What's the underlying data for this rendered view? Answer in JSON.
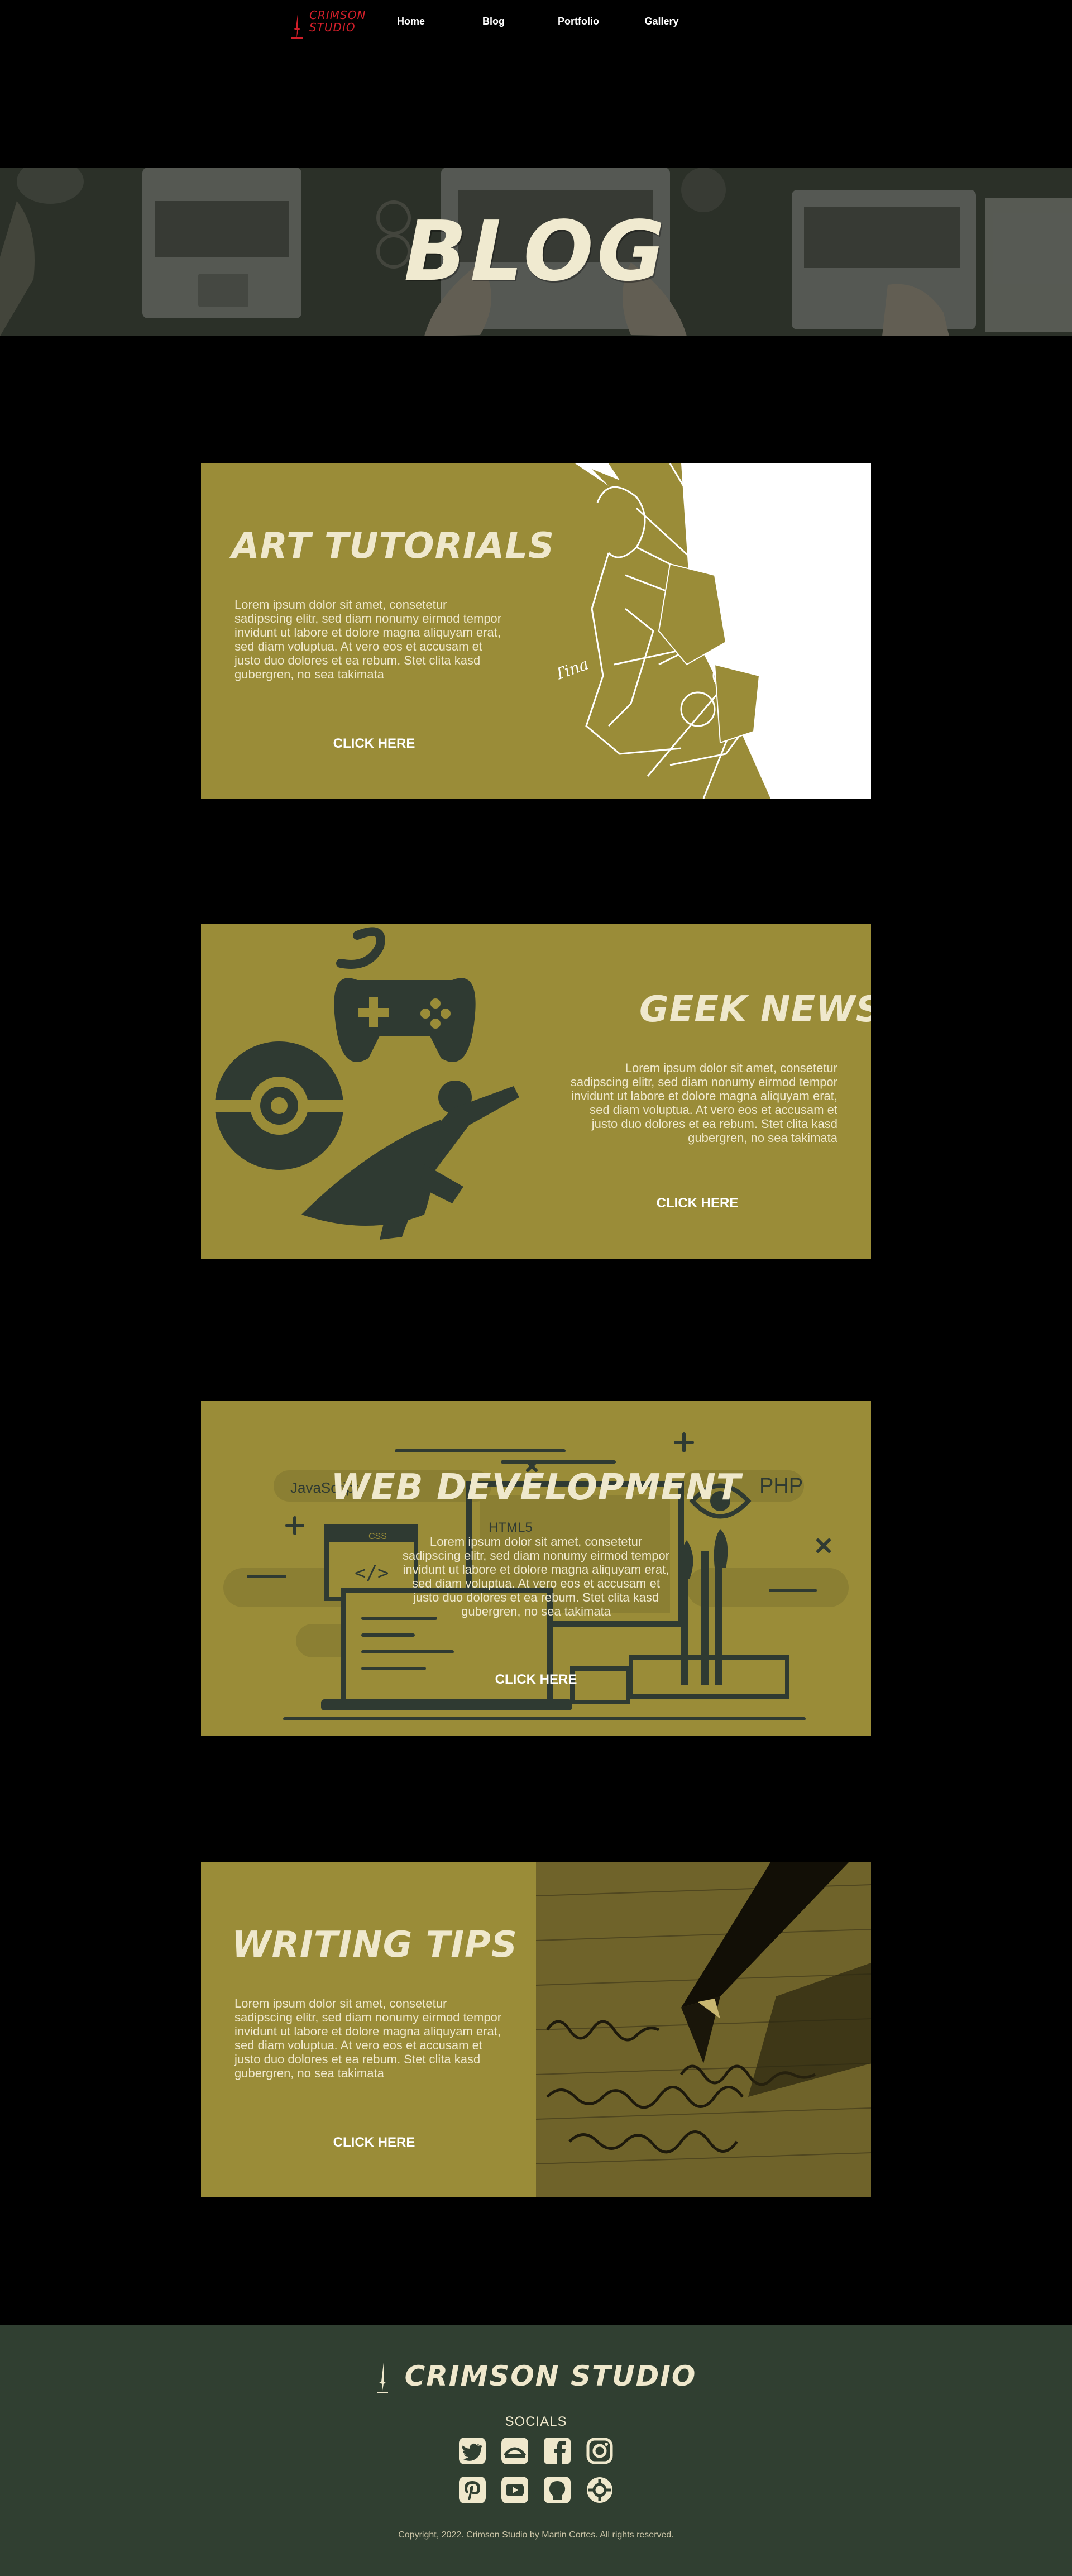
{
  "nav": {
    "logo_text_line1": "CRIMSON",
    "logo_text_line2": "STUDIO",
    "links": [
      "Home",
      "Blog",
      "Portfolio",
      "Gallery"
    ]
  },
  "hero": {
    "title": "BLOG"
  },
  "cards": [
    {
      "title": "ART TUTORIALS",
      "body": "Lorem ipsum dolor sit amet, consetetur sadipscing elitr, sed diam nonumy eirmod tempor invidunt ut labore et dolore magna aliquyam erat, sed diam voluptua. At vero eos et accusam et justo duo dolores et ea rebum. Stet clita kasd gubergren, no sea takimata",
      "button": "CLICK HERE"
    },
    {
      "title": "GEEK NEWS",
      "body": "Lorem ipsum dolor sit amet, consetetur sadipscing elitr, sed diam nonumy eirmod tempor invidunt ut labore et dolore magna aliquyam erat, sed diam voluptua. At vero eos et accusam et justo duo dolores et ea rebum. Stet clita kasd gubergren, no sea takimata",
      "button": "CLICK HERE"
    },
    {
      "title": "WEB DEVELOPMENT",
      "body": "Lorem ipsum dolor sit amet, consetetur sadipscing elitr, sed diam nonumy eirmod tempor invidunt ut labore et dolore magna aliquyam erat, sed diam voluptua. At vero eos et accusam et justo duo dolores et ea rebum. Stet clita kasd gubergren, no sea takimata",
      "button": "CLICK HERE",
      "art_labels": {
        "js": "JavaScript",
        "php": "PHP",
        "html": "HTML5",
        "css": "CSS",
        "code": "</>"
      }
    },
    {
      "title": "WRITING TIPS",
      "body": "Lorem ipsum dolor sit amet, consetetur sadipscing elitr, sed diam nonumy eirmod tempor invidunt ut labore et dolore magna aliquyam erat, sed diam voluptua. At vero eos et accusam et justo duo dolores et ea rebum. Stet clita kasd gubergren, no sea takimata",
      "button": "CLICK HERE"
    }
  ],
  "footer": {
    "logo_text": "CRIMSON STUDIO",
    "socials_label": "SOCIALS",
    "social_icons": [
      "twitter-icon",
      "deviantart-icon",
      "facebook-icon",
      "instagram-icon",
      "pinterest-icon",
      "youtube-icon",
      "github-icon",
      "crimson-badge-icon"
    ],
    "copyright": "Copyright, 2022. Crimson Studio by Martin Cortes. All rights reserved."
  },
  "colors": {
    "card": "#9a8c38",
    "card_text": "#efe8cc",
    "footer": "#303f31",
    "logo_red": "#d11f2a",
    "illustration_dark": "#2f3a32"
  }
}
